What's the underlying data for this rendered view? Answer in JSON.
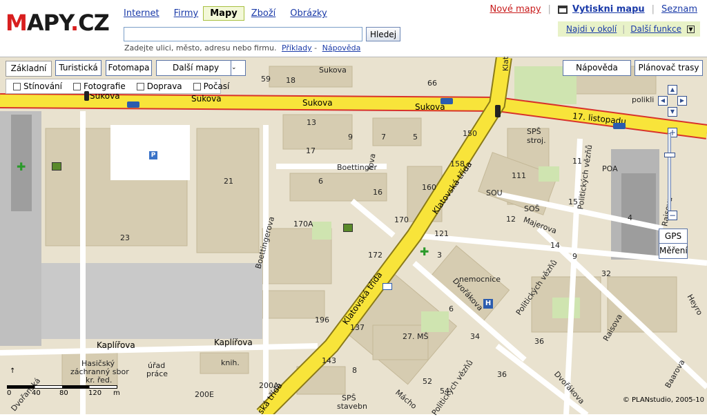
{
  "header": {
    "logo": {
      "m": "M",
      "rest": "APY",
      "dot": ".",
      "cz": "CZ"
    },
    "nav": [
      "Internet",
      "Firmy",
      "Mapy",
      "Zboží",
      "Obrázky"
    ],
    "search_button": "Hledej",
    "hint": "Zadejte ulici, město, adresu nebo firmu.",
    "hint_examples": "Příklady",
    "hint_dash": "-",
    "hint_help": "Nápověda",
    "new_maps": "Nové mapy",
    "print": "Vytiskni mapu",
    "list": "Seznam",
    "nearby": "Najdi v okolí",
    "more_functions": "Další funkce"
  },
  "map_tabs": [
    "Základní",
    "Turistická",
    "Fotomapa"
  ],
  "more_maps": "Další mapy",
  "help_button": "Nápověda",
  "route_planner": "Plánovač trasy",
  "layers": [
    "Stínování",
    "Fotografie",
    "Doprava",
    "Počasí"
  ],
  "tools": {
    "gps": "GPS",
    "measure": "Měření"
  },
  "streets": {
    "sukova1": "Sukova",
    "sukova2": "Sukova",
    "sukova3": "Sukova",
    "sukova4": "Sukova",
    "sukova5": "Sukova",
    "listopadu": "17. listopadu",
    "klatovska1": "Klatovská třída",
    "klatovska2": "Klatovská třída",
    "klatovska3": "ská třída",
    "klatovska_top": "Klat",
    "boettingerova_h": "Boettinger",
    "boettingerova_v": "Boettingerova",
    "kaplirova1": "Kaplířova",
    "kaplirova2": "Kaplířova",
    "majerova": "Majerova",
    "dvorakova1": "Dvořákova",
    "dvorakova2": "Dvořákova",
    "politickych1": "Politických vězňů",
    "politickych2": "Politických vězňů",
    "politickych3": "Politických vězňů",
    "raisova1": "Raisova",
    "raisova2": "Raisova",
    "baarova": "Baarova",
    "heyrovskeho": "Heyro",
    "dvoranska": "Dvořanská",
    "machova": "Mácho",
    "rova": "rova"
  },
  "places": {
    "sps": "SPŠ",
    "stroj": "stroj.",
    "poa": "POA",
    "sou": "SOU",
    "sos": "SOŠ",
    "nemocnice": "nemocnice",
    "ms": "27. MŠ",
    "hasicsky1": "Hasičský",
    "hasicsky2": "záchranný sbor",
    "hasicsky3": "kr. řed.",
    "urad1": "úřad",
    "urad2": "práce",
    "knih": "knih.",
    "sps2": "SPŠ",
    "stavebni": "stavebn",
    "polikli": "polikli"
  },
  "house_numbers": [
    "59",
    "18",
    "66",
    "13",
    "9",
    "7",
    "5",
    "150",
    "17",
    "158",
    "6",
    "16",
    "160",
    "21",
    "111",
    "170A",
    "170",
    "23",
    "4",
    "12",
    "14",
    "172",
    "121",
    "3",
    "9",
    "32",
    "196",
    "137",
    "6",
    "34",
    "36",
    "143",
    "8",
    "200A",
    "200E",
    "52",
    "54",
    "36",
    "11",
    "15"
  ],
  "scale": {
    "labels": [
      "0",
      "40",
      "80",
      "120",
      "m"
    ]
  },
  "copyright": "© PLANstudio, 2005-10"
}
